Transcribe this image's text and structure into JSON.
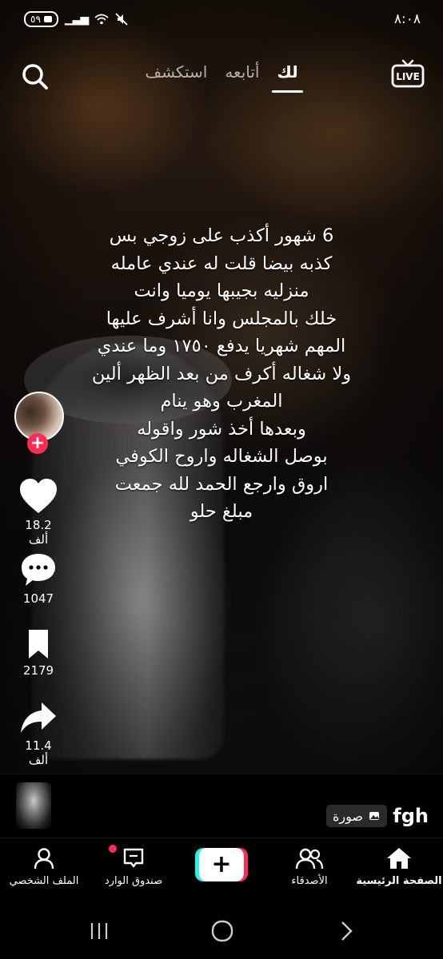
{
  "status_bar": {
    "time": "٨:٠٨",
    "battery": "٥٩"
  },
  "top_nav": {
    "tabs": [
      "استكشف",
      "أتابعه",
      "لك"
    ],
    "active_tab": "لك",
    "live_label": "LIVE"
  },
  "caption": {
    "lines": [
      "6 شهور أكذب على زوجي بس",
      "كذبه بيضا قلت له عندي عامله",
      "منزليه بجيبها يوميا وانت",
      "خلك بالمجلس وانا أشرف عليها",
      "المهم شهريا يدفع ١٧٥٠ وما عندي",
      "ولا شغاله أكرف من بعد الظهر ألين",
      "المغرب وهو ينام",
      "وبعدها أخذ شور واقوله",
      "بوصل الشغاله واروح الكوفي",
      "اروق وارجع الحمد لله جمعت",
      "مبلغ حلو"
    ]
  },
  "actions": {
    "likes": "18.2 ألف",
    "comments": "1047",
    "saves": "2179",
    "shares": "11.4 ألف"
  },
  "post_info": {
    "username": "fgh",
    "photo_badge": "صورة"
  },
  "tab_bar": {
    "home": "الصفحة الرئيسية",
    "friends": "الأصدقاء",
    "inbox": "صندوق الوارد",
    "profile": "الملف الشخصي"
  },
  "colors": {
    "accent_red": "#fe2c55",
    "accent_cyan": "#25f4ee"
  }
}
